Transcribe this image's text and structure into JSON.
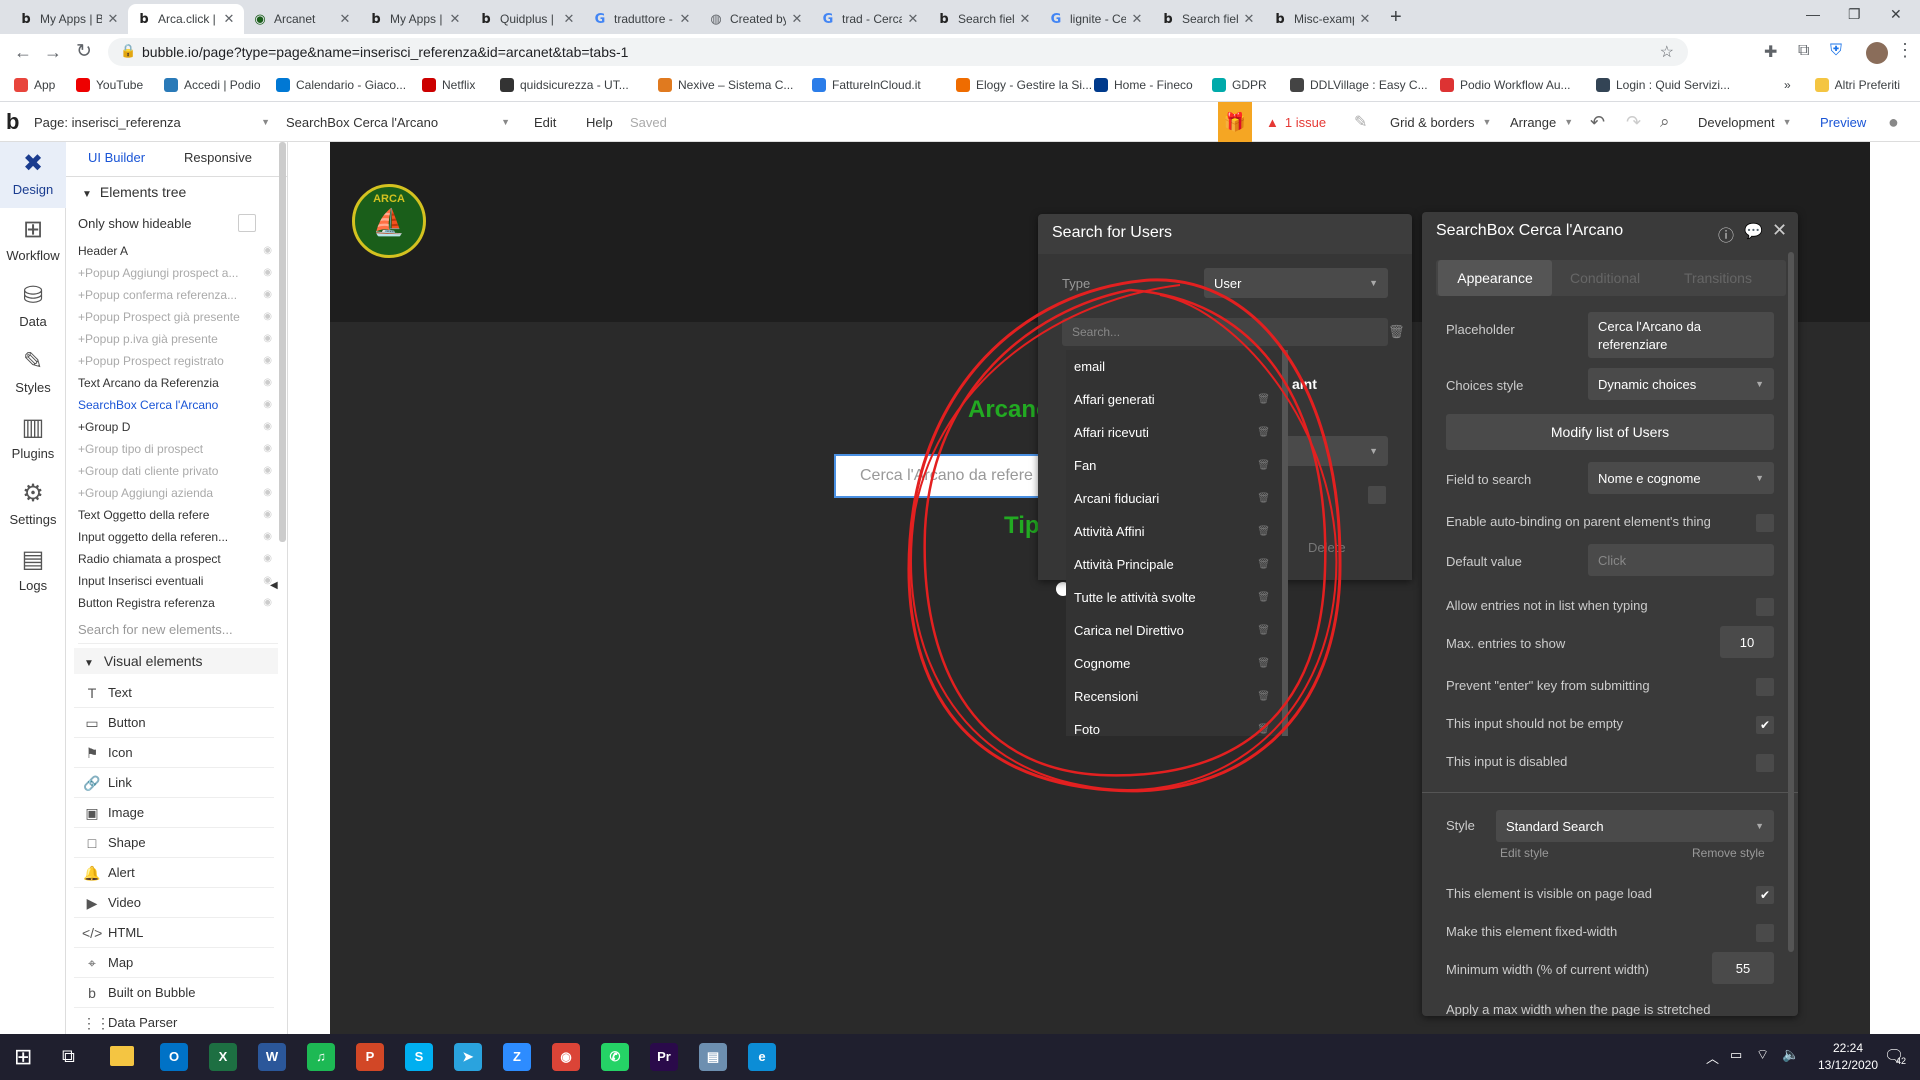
{
  "browser": {
    "tabs": [
      {
        "title": "My Apps | Bu",
        "icon": "bubble-icon"
      },
      {
        "title": "Arca.click | Bu",
        "icon": "bubble-icon",
        "active": true
      },
      {
        "title": "Arcanet",
        "icon": "arca-icon"
      },
      {
        "title": "My Apps | Bu",
        "icon": "bubble-icon"
      },
      {
        "title": "Quidplus | Bu",
        "icon": "bubble-icon"
      },
      {
        "title": "traduttore - C",
        "icon": "google-icon"
      },
      {
        "title": "Created by Ca",
        "icon": "globe-icon"
      },
      {
        "title": "trad - Cerca c",
        "icon": "google-icon"
      },
      {
        "title": "Search field th",
        "icon": "bubble-icon"
      },
      {
        "title": "lignite - Cerc",
        "icon": "google-icon"
      },
      {
        "title": "Search field th",
        "icon": "bubble-icon"
      },
      {
        "title": "Misc-example",
        "icon": "bubble-icon"
      }
    ],
    "url": "bubble.io/page?type=page&name=inserisci_referenza&id=arcanet&tab=tabs-1",
    "bookmarks": [
      {
        "label": "App",
        "color": "#e8453c"
      },
      {
        "label": "YouTube",
        "color": "#e00"
      },
      {
        "label": "Accedi | Podio",
        "color": "#2a7ab8"
      },
      {
        "label": "Calendario - Giaco...",
        "color": "#0078d4"
      },
      {
        "label": "Netflix",
        "color": "#c00"
      },
      {
        "label": "quidsicurezza - UT...",
        "color": "#333"
      },
      {
        "label": "Nexive – Sistema C...",
        "color": "#e07a1f"
      },
      {
        "label": "FattureInCloud.it",
        "color": "#2b7de9"
      },
      {
        "label": "Elogy - Gestire la Si...",
        "color": "#ef6c00"
      },
      {
        "label": "Home - Fineco",
        "color": "#003a8c"
      },
      {
        "label": "GDPR",
        "color": "#0aa"
      },
      {
        "label": "DDLVillage : Easy C...",
        "color": "#444"
      },
      {
        "label": "Podio Workflow Au...",
        "color": "#d33"
      },
      {
        "label": "Login : Quid Servizi...",
        "color": "#345"
      }
    ],
    "other_bookmarks": "Altri Preferiti"
  },
  "header": {
    "page_label": "Page: inserisci_referenza",
    "element_label": "SearchBox Cerca l'Arcano",
    "edit": "Edit",
    "help": "Help",
    "saved": "Saved",
    "issues": "1 issue",
    "grid": "Grid & borders",
    "arrange": "Arrange",
    "development": "Development",
    "preview": "Preview"
  },
  "leftnav": [
    {
      "label": "Design",
      "icon": "design-icon"
    },
    {
      "label": "Workflow",
      "icon": "workflow-icon"
    },
    {
      "label": "Data",
      "icon": "database-icon"
    },
    {
      "label": "Styles",
      "icon": "brush-icon"
    },
    {
      "label": "Plugins",
      "icon": "plugin-icon"
    },
    {
      "label": "Settings",
      "icon": "gear-icon"
    },
    {
      "label": "Logs",
      "icon": "logs-icon"
    }
  ],
  "palette": {
    "tabs": [
      "UI Builder",
      "Responsive"
    ],
    "elements_tree": "Elements tree",
    "only_show_hideable": "Only show hideable",
    "tree": [
      {
        "label": "Header A",
        "style": "normal"
      },
      {
        "label": "+Popup Aggiungi prospect a...",
        "style": "dim"
      },
      {
        "label": "+Popup conferma referenza...",
        "style": "dim"
      },
      {
        "label": "+Popup Prospect già presente",
        "style": "dim"
      },
      {
        "label": "+Popup p.iva già presente",
        "style": "dim"
      },
      {
        "label": "+Popup Prospect registrato",
        "style": "dim"
      },
      {
        "label": "Text Arcano da Referenzia",
        "style": "normal"
      },
      {
        "label": "SearchBox Cerca l'Arcano",
        "style": "cur"
      },
      {
        "label": "+Group D",
        "style": "normal"
      },
      {
        "label": "+Group tipo di prospect",
        "style": "dim"
      },
      {
        "label": "+Group dati cliente privato",
        "style": "dim"
      },
      {
        "label": "+Group Aggiungi azienda",
        "style": "dim"
      },
      {
        "label": "Text Oggetto della refere",
        "style": "normal"
      },
      {
        "label": "Input oggetto della referen...",
        "style": "normal"
      },
      {
        "label": "Radio chiamata a prospect",
        "style": "normal"
      },
      {
        "label": "Input Inserisci eventuali",
        "style": "normal"
      },
      {
        "label": "Button Registra referenza",
        "style": "normal"
      }
    ],
    "search_placeholder": "Search for new elements...",
    "visual_elements": "Visual elements",
    "visual": [
      {
        "label": "Text",
        "icon": "T"
      },
      {
        "label": "Button",
        "icon": "▭"
      },
      {
        "label": "Icon",
        "icon": "⚑"
      },
      {
        "label": "Link",
        "icon": "🔗"
      },
      {
        "label": "Image",
        "icon": "▣"
      },
      {
        "label": "Shape",
        "icon": "□"
      },
      {
        "label": "Alert",
        "icon": "🔔"
      },
      {
        "label": "Video",
        "icon": "▶"
      },
      {
        "label": "HTML",
        "icon": "</>"
      },
      {
        "label": "Map",
        "icon": "⌖"
      },
      {
        "label": "Built on Bubble",
        "icon": "b"
      },
      {
        "label": "Data Parser",
        "icon": "⋮⋮"
      }
    ]
  },
  "canvas": {
    "logo_text": "ARCA",
    "searchbox_placeholder": "Cerca l'Arcano da refere",
    "green_text_1": "Arcano",
    "green_text_2": "Tip"
  },
  "search_popup": {
    "title": "Search for Users",
    "type_label": "Type",
    "type_value": "User",
    "search_placeholder": "Search...",
    "constraint_partial": "aint",
    "delete_label": "Delete",
    "fields": [
      "email",
      "Affari generati",
      "Affari ricevuti",
      "Fan",
      "Arcani fiduciari",
      "Attività Affini",
      "Attività Principale",
      "Tutte le attività svolte",
      "Carica nel Direttivo",
      "Cognome",
      "Recensioni",
      "Foto"
    ]
  },
  "property_editor": {
    "title": "SearchBox Cerca l'Arcano",
    "tabs": [
      "Appearance",
      "Conditional",
      "Transitions"
    ],
    "placeholder_label": "Placeholder",
    "placeholder_value": "Cerca l'Arcano da referenziare",
    "choices_style_label": "Choices style",
    "choices_style_value": "Dynamic choices",
    "modify_list": "Modify list of Users",
    "field_to_search_label": "Field to search",
    "field_to_search_value": "Nome e cognome",
    "auto_binding": "Enable auto-binding on parent element's thing",
    "default_value_label": "Default value",
    "default_value_placeholder": "Click",
    "allow_entries": "Allow entries not in list when typing",
    "max_entries_label": "Max. entries to show",
    "max_entries_value": "10",
    "prevent_enter": "Prevent \"enter\" key from submitting",
    "not_empty": "This input should not be empty",
    "disabled": "This input is disabled",
    "style_label": "Style",
    "style_value": "Standard Search",
    "edit_style": "Edit style",
    "remove_style": "Remove style",
    "visible_on_load": "This element is visible on page load",
    "fixed_width": "Make this element fixed-width",
    "min_width_label": "Minimum width (% of current width)",
    "min_width_value": "55",
    "max_width_partial": "Apply a max width when the page is stretched"
  },
  "taskbar": {
    "time": "22:24",
    "date": "13/12/2020",
    "notifications": "42",
    "apps": [
      {
        "label": "O",
        "color": "#0072c6",
        "name": "outlook-icon"
      },
      {
        "label": "X",
        "color": "#1d6f42",
        "name": "excel-icon"
      },
      {
        "label": "W",
        "color": "#2b579a",
        "name": "word-icon"
      },
      {
        "label": "♫",
        "color": "#1db954",
        "name": "spotify-icon"
      },
      {
        "label": "P",
        "color": "#d24726",
        "name": "powerpoint-icon"
      },
      {
        "label": "S",
        "color": "#00aff0",
        "name": "skype-icon"
      },
      {
        "label": "➤",
        "color": "#2aa3de",
        "name": "telegram-icon"
      },
      {
        "label": "Z",
        "color": "#2d8cff",
        "name": "zoom-icon"
      },
      {
        "label": "◉",
        "color": "#db4437",
        "name": "chrome-icon"
      },
      {
        "label": "✆",
        "color": "#25d366",
        "name": "whatsapp-icon"
      },
      {
        "label": "Pr",
        "color": "#2a0a4a",
        "name": "premiere-icon"
      },
      {
        "label": "▤",
        "color": "#6d8fb0",
        "name": "notepad-icon"
      },
      {
        "label": "e",
        "color": "#0c8dd6",
        "name": "edge-icon"
      }
    ]
  }
}
